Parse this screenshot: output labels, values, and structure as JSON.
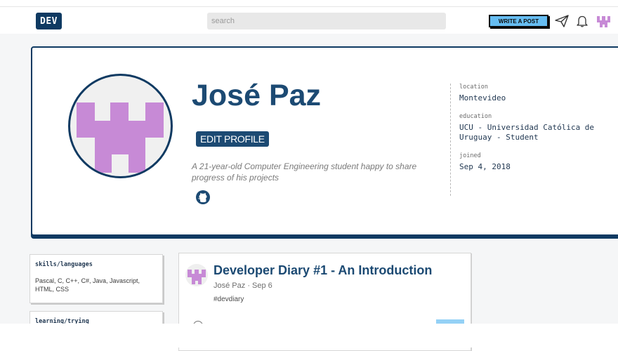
{
  "nav": {
    "logo": "DEV",
    "search_placeholder": "search",
    "write_post_label": "WRITE A POST"
  },
  "profile": {
    "name": "José Paz",
    "edit_label": "EDIT PROFILE",
    "summary": "A 21-year-old Computer Engineering student happy to share progress of his projects",
    "details": [
      {
        "key": "location",
        "value": "Montevideo"
      },
      {
        "key": "education",
        "value": "UCU - Universidad Católica de Uruguay - Student"
      },
      {
        "key": "joined",
        "value": "Sep 4, 2018"
      }
    ]
  },
  "sidebar": {
    "skills": {
      "title": "skills/languages",
      "body": "Pascal, C, C++, C#, Java, Javascript, HTML, CSS"
    },
    "learning": {
      "title": "learning/trying"
    }
  },
  "post": {
    "title": "Developer Diary #1 - An Introduction",
    "author": "José Paz",
    "date": "Sep 6",
    "tag": "#devdiary"
  },
  "colors": {
    "brand_navy": "#0f3a62",
    "title_blue": "#1c4a73",
    "avatar_purple": "#c78ad6",
    "button_blue": "#66bdf2"
  }
}
